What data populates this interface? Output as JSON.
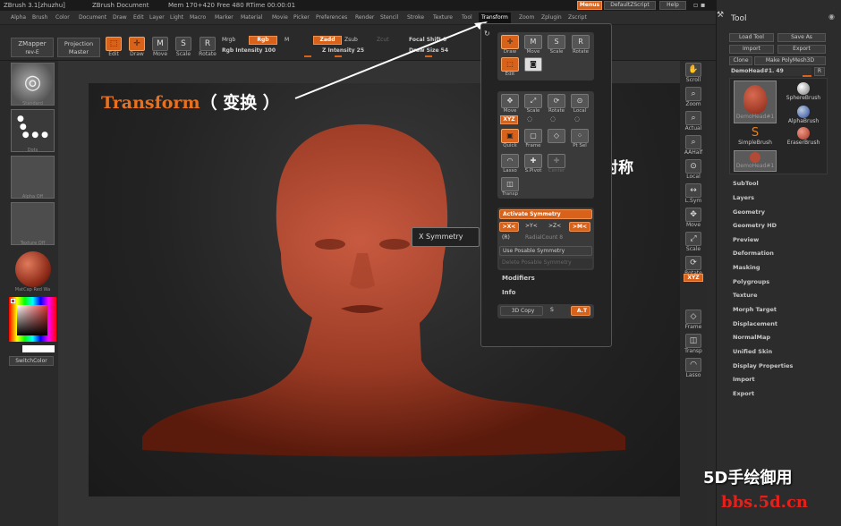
{
  "titlebar": {
    "app": "ZBrush  3.1[zhuzhu]",
    "doc": "ZBrush Document",
    "mem": "Mem 170+420  Free 480  RTime 00:00:01",
    "menus": "Menus",
    "script": "DefaultZScript",
    "help": "Help"
  },
  "menu": [
    "Alpha",
    "Brush",
    "Color",
    "Document",
    "Draw",
    "Edit",
    "Layer",
    "Light",
    "Macro",
    "Marker",
    "Material",
    "Movie",
    "Picker",
    "Preferences",
    "Render",
    "Stencil",
    "Stroke",
    "Texture",
    "Tool",
    "Transform",
    "Zoom",
    "Zplugin",
    "Zscript"
  ],
  "shelf": {
    "zmapper": "ZMapper",
    "zmapper_sub": "rev-E",
    "projection": "Projection",
    "projection_sub": "Master",
    "edit": "Edit",
    "draw": "Draw",
    "move": "Move",
    "scale": "Scale",
    "rotate": "Rotate",
    "mrgb": "Mrgb",
    "rgb": "Rgb",
    "m": "M",
    "rgb_intensity": "Rgb Intensity 100",
    "zadd": "Zadd",
    "zsub": "Zsub",
    "zcut": "Zcut",
    "z_intensity": "Z Intensity 25",
    "focal_shift": "Focal Shift 0",
    "draw_size": "Draw Size 54"
  },
  "left": {
    "standard": "Standard",
    "dots": "Dots",
    "alpha": "Alpha  Off",
    "texture": "Texture  Off",
    "matcap": "MatCap Red Wa",
    "switchcolor": "SwitchColor"
  },
  "popup": {
    "edit": "Edit",
    "draw": "Draw",
    "move": "Move",
    "scale": "Scale",
    "rotate": "Rotate",
    "local": "Local",
    "xyz": "XYZ",
    "quick": "Quick",
    "frame": "Frame",
    "ptsel": "Pt Sel",
    "lasso": "Lasso",
    "spivot": "S.Pivot",
    "center": "Center",
    "transp": "Transp",
    "activate_symmetry": "Activate Symmetry",
    "x": ">X<",
    "y": ">Y<",
    "z": ">Z<",
    "m": ">M<",
    "r": "(R)",
    "radial": "RadialCount 8",
    "posable": "Use Posable Symmetry",
    "delete_posable": "Delete Posable Symmetry",
    "modifiers": "Modifiers",
    "info": "Info",
    "copy3d": "3D Copy",
    "s": "S",
    "at": "A.T"
  },
  "tooltip": "X Symmetry",
  "rightshelf": [
    "Scroll",
    "Zoom",
    "Actual",
    "AAHalf",
    "Local",
    "L.Sym",
    "Move",
    "Scale",
    "Rotate",
    "XYZ",
    "Frame",
    "Transp",
    "Lasso"
  ],
  "tool": {
    "title": "Tool",
    "load": "Load Tool",
    "saveas": "Save As",
    "import": "Import",
    "export": "Export",
    "clone": "Clone",
    "polymesh": "Make PolyMesh3D",
    "current": "DemoHead#1. 49",
    "r": "R",
    "items": [
      "DemoHead#1",
      "SphereBrush",
      "AlphaBrush",
      "SimpleBrush",
      "EraserBrush",
      "DemoHead#1"
    ],
    "menus": [
      "SubTool",
      "Layers",
      "Geometry",
      "Geometry HD",
      "Preview",
      "Deformation",
      "Masking",
      "Polygroups",
      "Texture",
      "Morph Target",
      "Displacement",
      "NormalMap",
      "Unified Skin",
      "Display Properties",
      "Import",
      "Export"
    ]
  },
  "annotations": {
    "transform_en": "Transform",
    "transform_cn": "（ 变换 ）",
    "symmetry_cn": "激活对称"
  },
  "watermark": {
    "line1": "5D手绘御用",
    "line2": "bbs.5d.cn"
  },
  "colors": {
    "accent": "#d8621a",
    "bg": "#2b2b2b",
    "head": "#b24a35"
  }
}
